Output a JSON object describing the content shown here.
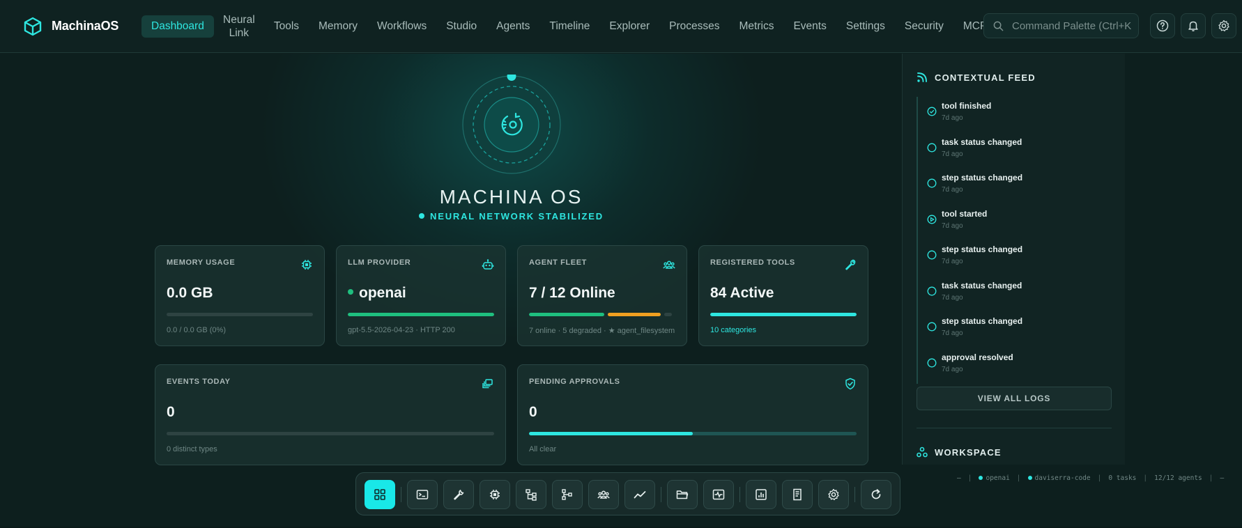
{
  "app": {
    "name": "MachinaOS"
  },
  "nav": {
    "items": [
      {
        "label": "Dashboard",
        "active": true
      },
      {
        "label": "Neural Link",
        "line1": "Neural",
        "line2": "Link"
      },
      {
        "label": "Tools"
      },
      {
        "label": "Memory"
      },
      {
        "label": "Workflows"
      },
      {
        "label": "Studio"
      },
      {
        "label": "Agents"
      },
      {
        "label": "Timeline"
      },
      {
        "label": "Explorer"
      },
      {
        "label": "Processes"
      },
      {
        "label": "Metrics"
      },
      {
        "label": "Events"
      },
      {
        "label": "Settings"
      },
      {
        "label": "Security"
      },
      {
        "label": "MCP"
      }
    ],
    "command_palette_placeholder": "Command Palette (Ctrl+K",
    "icons": [
      "help-icon",
      "bell-icon",
      "gear-icon"
    ]
  },
  "hero": {
    "title": "MACHINA OS",
    "status": "NEURAL NETWORK STABILIZED"
  },
  "cards": {
    "memory": {
      "label": "MEMORY USAGE",
      "value": "0.0 GB",
      "sub": "0.0 / 0.0 GB (0%)",
      "percent": 0,
      "icon": "chip-icon"
    },
    "llm": {
      "label": "LLM PROVIDER",
      "value": "openai",
      "sub": "gpt-5.5-2026-04-23 · HTTP 200",
      "percent": 100,
      "icon": "robot-icon"
    },
    "fleet": {
      "label": "AGENT FLEET",
      "value": "7 / 12 Online",
      "sub": "7 online · 5 degraded · ★ agent_filesystem",
      "online": 7,
      "degraded": 5,
      "total": 12,
      "icon": "group-icon"
    },
    "tools": {
      "label": "REGISTERED TOOLS",
      "value": "84 Active",
      "sub": "10 categories",
      "percent": 100,
      "icon": "wrench-icon"
    },
    "events": {
      "label": "EVENTS TODAY",
      "value": "0",
      "sub": "0 distinct types",
      "percent": 0,
      "icon": "stack-icon"
    },
    "approvals": {
      "label": "PENDING APPROVALS",
      "value": "0",
      "sub": "All clear",
      "percent": 50,
      "icon": "shield-check-icon"
    }
  },
  "feed": {
    "title": "CONTEXTUAL FEED",
    "items": [
      {
        "event": "tool finished",
        "ago": "7d ago",
        "icon": "check-circle-icon"
      },
      {
        "event": "task status changed",
        "ago": "7d ago",
        "icon": "circle-icon"
      },
      {
        "event": "step status changed",
        "ago": "7d ago",
        "icon": "circle-icon"
      },
      {
        "event": "tool started",
        "ago": "7d ago",
        "icon": "play-circle-icon"
      },
      {
        "event": "step status changed",
        "ago": "7d ago",
        "icon": "circle-icon"
      },
      {
        "event": "task status changed",
        "ago": "7d ago",
        "icon": "circle-icon"
      },
      {
        "event": "step status changed",
        "ago": "7d ago",
        "icon": "circle-icon"
      },
      {
        "event": "approval resolved",
        "ago": "7d ago",
        "icon": "circle-icon"
      }
    ],
    "view_all": "VIEW ALL LOGS",
    "workspace_title": "WORKSPACE"
  },
  "status_strip": {
    "lead": "—",
    "provider": "openai",
    "workspace": "daviserra-code",
    "tasks": "0 tasks",
    "agents": "12/12 agents",
    "trail": "—"
  },
  "dock": {
    "items": [
      "grid-icon",
      "terminal-icon",
      "wrench-icon",
      "chip-icon",
      "flow-icon",
      "tree-icon",
      "group-icon",
      "trend-icon",
      "folder-icon",
      "pulse-icon",
      "chart-icon",
      "doc-icon",
      "gear-icon",
      "refresh-icon"
    ],
    "active": "grid-icon"
  },
  "colors": {
    "accent": "#2ee6e0",
    "green": "#1fbf7f",
    "amber": "#f0a020",
    "background": "#0d1f1e"
  }
}
